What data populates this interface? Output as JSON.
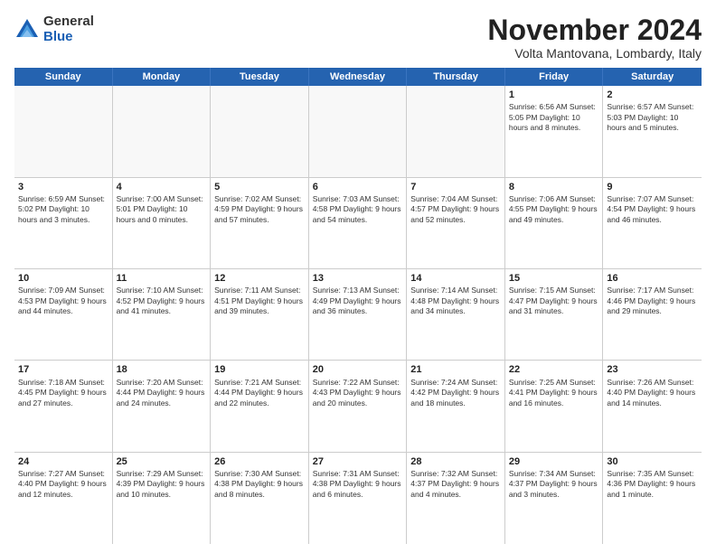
{
  "logo": {
    "general": "General",
    "blue": "Blue"
  },
  "title": "November 2024",
  "subtitle": "Volta Mantovana, Lombardy, Italy",
  "header": {
    "days": [
      "Sunday",
      "Monday",
      "Tuesday",
      "Wednesday",
      "Thursday",
      "Friday",
      "Saturday"
    ]
  },
  "weeks": [
    {
      "cells": [
        {
          "day": "",
          "info": "",
          "empty": true
        },
        {
          "day": "",
          "info": "",
          "empty": true
        },
        {
          "day": "",
          "info": "",
          "empty": true
        },
        {
          "day": "",
          "info": "",
          "empty": true
        },
        {
          "day": "",
          "info": "",
          "empty": true
        },
        {
          "day": "1",
          "info": "Sunrise: 6:56 AM\nSunset: 5:05 PM\nDaylight: 10 hours\nand 8 minutes."
        },
        {
          "day": "2",
          "info": "Sunrise: 6:57 AM\nSunset: 5:03 PM\nDaylight: 10 hours\nand 5 minutes."
        }
      ]
    },
    {
      "cells": [
        {
          "day": "3",
          "info": "Sunrise: 6:59 AM\nSunset: 5:02 PM\nDaylight: 10 hours\nand 3 minutes."
        },
        {
          "day": "4",
          "info": "Sunrise: 7:00 AM\nSunset: 5:01 PM\nDaylight: 10 hours\nand 0 minutes."
        },
        {
          "day": "5",
          "info": "Sunrise: 7:02 AM\nSunset: 4:59 PM\nDaylight: 9 hours\nand 57 minutes."
        },
        {
          "day": "6",
          "info": "Sunrise: 7:03 AM\nSunset: 4:58 PM\nDaylight: 9 hours\nand 54 minutes."
        },
        {
          "day": "7",
          "info": "Sunrise: 7:04 AM\nSunset: 4:57 PM\nDaylight: 9 hours\nand 52 minutes."
        },
        {
          "day": "8",
          "info": "Sunrise: 7:06 AM\nSunset: 4:55 PM\nDaylight: 9 hours\nand 49 minutes."
        },
        {
          "day": "9",
          "info": "Sunrise: 7:07 AM\nSunset: 4:54 PM\nDaylight: 9 hours\nand 46 minutes."
        }
      ]
    },
    {
      "cells": [
        {
          "day": "10",
          "info": "Sunrise: 7:09 AM\nSunset: 4:53 PM\nDaylight: 9 hours\nand 44 minutes."
        },
        {
          "day": "11",
          "info": "Sunrise: 7:10 AM\nSunset: 4:52 PM\nDaylight: 9 hours\nand 41 minutes."
        },
        {
          "day": "12",
          "info": "Sunrise: 7:11 AM\nSunset: 4:51 PM\nDaylight: 9 hours\nand 39 minutes."
        },
        {
          "day": "13",
          "info": "Sunrise: 7:13 AM\nSunset: 4:49 PM\nDaylight: 9 hours\nand 36 minutes."
        },
        {
          "day": "14",
          "info": "Sunrise: 7:14 AM\nSunset: 4:48 PM\nDaylight: 9 hours\nand 34 minutes."
        },
        {
          "day": "15",
          "info": "Sunrise: 7:15 AM\nSunset: 4:47 PM\nDaylight: 9 hours\nand 31 minutes."
        },
        {
          "day": "16",
          "info": "Sunrise: 7:17 AM\nSunset: 4:46 PM\nDaylight: 9 hours\nand 29 minutes."
        }
      ]
    },
    {
      "cells": [
        {
          "day": "17",
          "info": "Sunrise: 7:18 AM\nSunset: 4:45 PM\nDaylight: 9 hours\nand 27 minutes."
        },
        {
          "day": "18",
          "info": "Sunrise: 7:20 AM\nSunset: 4:44 PM\nDaylight: 9 hours\nand 24 minutes."
        },
        {
          "day": "19",
          "info": "Sunrise: 7:21 AM\nSunset: 4:44 PM\nDaylight: 9 hours\nand 22 minutes."
        },
        {
          "day": "20",
          "info": "Sunrise: 7:22 AM\nSunset: 4:43 PM\nDaylight: 9 hours\nand 20 minutes."
        },
        {
          "day": "21",
          "info": "Sunrise: 7:24 AM\nSunset: 4:42 PM\nDaylight: 9 hours\nand 18 minutes."
        },
        {
          "day": "22",
          "info": "Sunrise: 7:25 AM\nSunset: 4:41 PM\nDaylight: 9 hours\nand 16 minutes."
        },
        {
          "day": "23",
          "info": "Sunrise: 7:26 AM\nSunset: 4:40 PM\nDaylight: 9 hours\nand 14 minutes."
        }
      ]
    },
    {
      "cells": [
        {
          "day": "24",
          "info": "Sunrise: 7:27 AM\nSunset: 4:40 PM\nDaylight: 9 hours\nand 12 minutes."
        },
        {
          "day": "25",
          "info": "Sunrise: 7:29 AM\nSunset: 4:39 PM\nDaylight: 9 hours\nand 10 minutes."
        },
        {
          "day": "26",
          "info": "Sunrise: 7:30 AM\nSunset: 4:38 PM\nDaylight: 9 hours\nand 8 minutes."
        },
        {
          "day": "27",
          "info": "Sunrise: 7:31 AM\nSunset: 4:38 PM\nDaylight: 9 hours\nand 6 minutes."
        },
        {
          "day": "28",
          "info": "Sunrise: 7:32 AM\nSunset: 4:37 PM\nDaylight: 9 hours\nand 4 minutes."
        },
        {
          "day": "29",
          "info": "Sunrise: 7:34 AM\nSunset: 4:37 PM\nDaylight: 9 hours\nand 3 minutes."
        },
        {
          "day": "30",
          "info": "Sunrise: 7:35 AM\nSunset: 4:36 PM\nDaylight: 9 hours\nand 1 minute."
        }
      ]
    }
  ]
}
